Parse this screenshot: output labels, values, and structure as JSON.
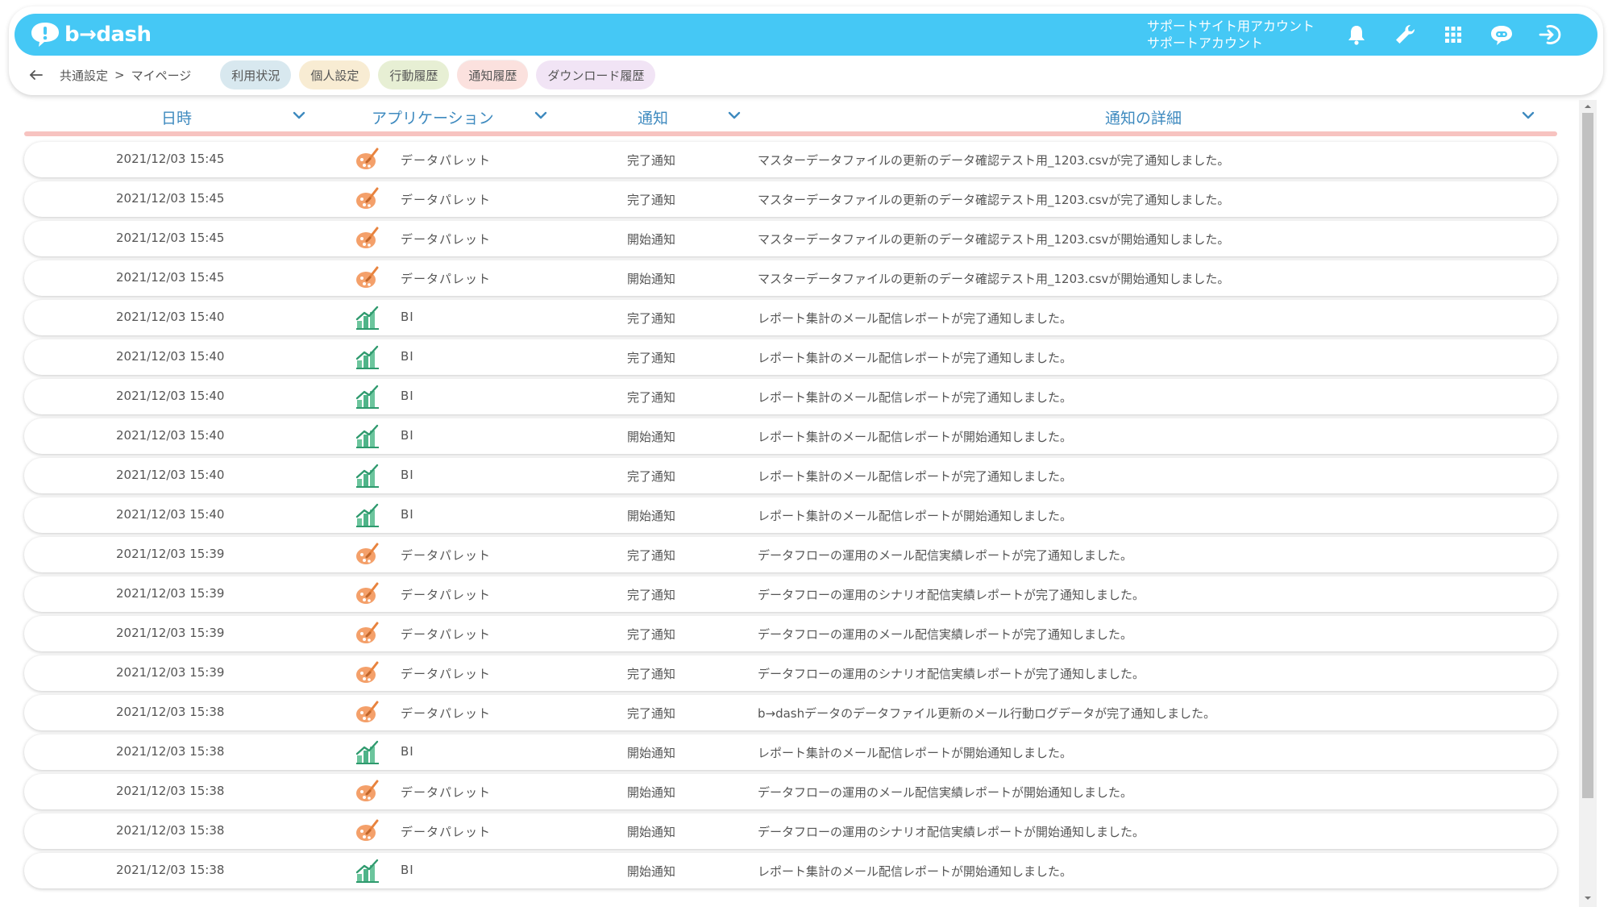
{
  "app": {
    "logo_text": "b→dash"
  },
  "account": {
    "line1": "サポートサイト用アカウント",
    "line2": "サポートアカウント"
  },
  "icons": [
    "bell-icon",
    "wrench-icon",
    "grid-icon",
    "chat-bot-icon",
    "logout-icon"
  ],
  "breadcrumb": {
    "parent": "共通設定",
    "separator": ">",
    "current": "マイページ"
  },
  "tabs": [
    {
      "label": "利用状況",
      "color": "#d8e8ef"
    },
    {
      "label": "個人設定",
      "color": "#f8ecd3"
    },
    {
      "label": "行動履歴",
      "color": "#e7efd4"
    },
    {
      "label": "通知履歴",
      "color": "#fbe1de",
      "active": true
    },
    {
      "label": "ダウンロード履歴",
      "color": "#f1e4f5"
    }
  ],
  "columns": {
    "date": "日時",
    "app": "アプリケーション",
    "type": "通知",
    "detail": "通知の詳細"
  },
  "colors": {
    "topbar": "#45c8f5",
    "header_text": "#3e8abf",
    "header_line": "#f7c3c0"
  },
  "rows": [
    {
      "date": "2021/12/03 15:45",
      "icon": "palette-icon",
      "app": "データパレット",
      "type": "完了通知",
      "detail": "マスターデータファイルの更新のデータ確認テスト用_1203.csvが完了通知しました。"
    },
    {
      "date": "2021/12/03 15:45",
      "icon": "palette-icon",
      "app": "データパレット",
      "type": "完了通知",
      "detail": "マスターデータファイルの更新のデータ確認テスト用_1203.csvが完了通知しました。"
    },
    {
      "date": "2021/12/03 15:45",
      "icon": "palette-icon",
      "app": "データパレット",
      "type": "開始通知",
      "detail": "マスターデータファイルの更新のデータ確認テスト用_1203.csvが開始通知しました。"
    },
    {
      "date": "2021/12/03 15:45",
      "icon": "palette-icon",
      "app": "データパレット",
      "type": "開始通知",
      "detail": "マスターデータファイルの更新のデータ確認テスト用_1203.csvが開始通知しました。"
    },
    {
      "date": "2021/12/03 15:40",
      "icon": "bi-icon",
      "app": "BI",
      "type": "完了通知",
      "detail": "レポート集計のメール配信レポートが完了通知しました。"
    },
    {
      "date": "2021/12/03 15:40",
      "icon": "bi-icon",
      "app": "BI",
      "type": "完了通知",
      "detail": "レポート集計のメール配信レポートが完了通知しました。"
    },
    {
      "date": "2021/12/03 15:40",
      "icon": "bi-icon",
      "app": "BI",
      "type": "完了通知",
      "detail": "レポート集計のメール配信レポートが完了通知しました。"
    },
    {
      "date": "2021/12/03 15:40",
      "icon": "bi-icon",
      "app": "BI",
      "type": "開始通知",
      "detail": "レポート集計のメール配信レポートが開始通知しました。"
    },
    {
      "date": "2021/12/03 15:40",
      "icon": "bi-icon",
      "app": "BI",
      "type": "完了通知",
      "detail": "レポート集計のメール配信レポートが完了通知しました。"
    },
    {
      "date": "2021/12/03 15:40",
      "icon": "bi-icon",
      "app": "BI",
      "type": "開始通知",
      "detail": "レポート集計のメール配信レポートが開始通知しました。"
    },
    {
      "date": "2021/12/03 15:39",
      "icon": "palette-icon",
      "app": "データパレット",
      "type": "完了通知",
      "detail": "データフローの運用のメール配信実績レポートが完了通知しました。"
    },
    {
      "date": "2021/12/03 15:39",
      "icon": "palette-icon",
      "app": "データパレット",
      "type": "完了通知",
      "detail": "データフローの運用のシナリオ配信実績レポートが完了通知しました。"
    },
    {
      "date": "2021/12/03 15:39",
      "icon": "palette-icon",
      "app": "データパレット",
      "type": "完了通知",
      "detail": "データフローの運用のメール配信実績レポートが完了通知しました。"
    },
    {
      "date": "2021/12/03 15:39",
      "icon": "palette-icon",
      "app": "データパレット",
      "type": "完了通知",
      "detail": "データフローの運用のシナリオ配信実績レポートが完了通知しました。"
    },
    {
      "date": "2021/12/03 15:38",
      "icon": "palette-icon",
      "app": "データパレット",
      "type": "完了通知",
      "detail": "b→dashデータのデータファイル更新のメール行動ログデータが完了通知しました。"
    },
    {
      "date": "2021/12/03 15:38",
      "icon": "bi-icon",
      "app": "BI",
      "type": "開始通知",
      "detail": "レポート集計のメール配信レポートが開始通知しました。"
    },
    {
      "date": "2021/12/03 15:38",
      "icon": "palette-icon",
      "app": "データパレット",
      "type": "開始通知",
      "detail": "データフローの運用のメール配信実績レポートが開始通知しました。"
    },
    {
      "date": "2021/12/03 15:38",
      "icon": "palette-icon",
      "app": "データパレット",
      "type": "開始通知",
      "detail": "データフローの運用のシナリオ配信実績レポートが開始通知しました。"
    },
    {
      "date": "2021/12/03 15:38",
      "icon": "bi-icon",
      "app": "BI",
      "type": "開始通知",
      "detail": "レポート集計のメール配信レポートが開始通知しました。"
    }
  ]
}
